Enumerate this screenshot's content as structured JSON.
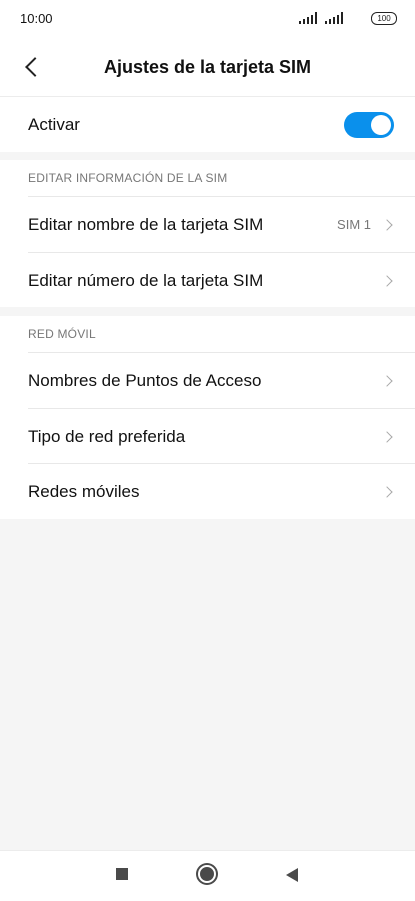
{
  "status_bar": {
    "time": "10:00",
    "battery": "100",
    "signal_icons": [
      "signal-icon",
      "signal-icon"
    ]
  },
  "header": {
    "title": "Ajustes de la tarjeta SIM",
    "back_icon": "chevron-left-icon"
  },
  "activate": {
    "label": "Activar",
    "enabled": true,
    "toggle_color": "#0a90ec"
  },
  "sections": [
    {
      "title": "EDITAR INFORMACIÓN DE LA SIM",
      "items": [
        {
          "label": "Editar nombre de la tarjeta SIM",
          "value": "SIM 1"
        },
        {
          "label": "Editar número de la tarjeta SIM",
          "value": ""
        }
      ]
    },
    {
      "title": "RED MÓVIL",
      "items": [
        {
          "label": "Nombres de Puntos de Acceso",
          "value": ""
        },
        {
          "label": "Tipo de red preferida",
          "value": ""
        },
        {
          "label": "Redes móviles",
          "value": ""
        }
      ]
    }
  ],
  "nav_bar": {
    "icons": [
      "recents-square-icon",
      "home-circle-icon",
      "back-triangle-icon"
    ]
  }
}
